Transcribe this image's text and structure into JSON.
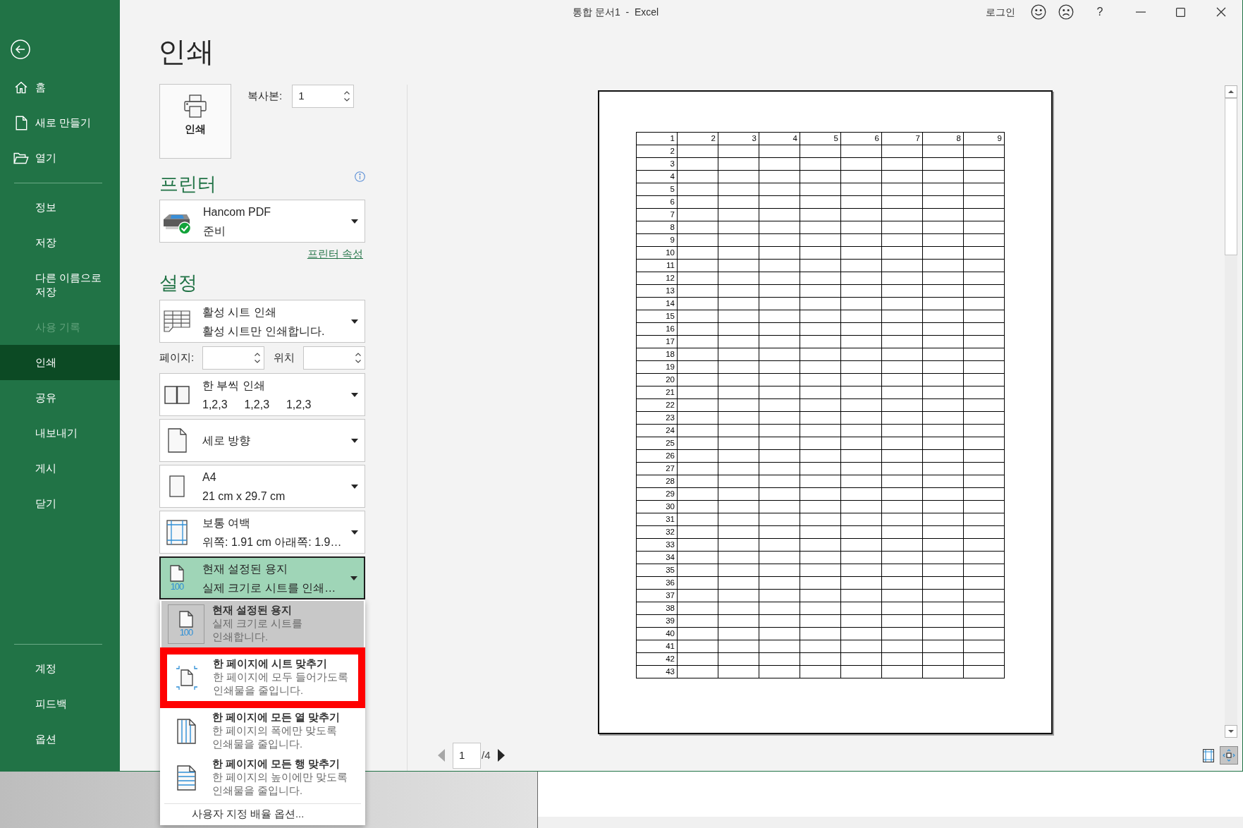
{
  "window": {
    "title": "통합 문서1  -  Excel",
    "sign_in": "로그인",
    "help": "?"
  },
  "nav": {
    "top": [
      {
        "label": "홈",
        "kind": "home",
        "selected": false
      },
      {
        "label": "새로 만들기",
        "kind": "new",
        "selected": false
      },
      {
        "label": "열기",
        "kind": "open",
        "selected": false
      }
    ],
    "main": [
      {
        "label": "정보",
        "selected": false,
        "disabled": false
      },
      {
        "label": "저장",
        "selected": false,
        "disabled": false
      },
      {
        "label": "다른 이름으로 저장",
        "selected": false,
        "disabled": false
      },
      {
        "label": "사용 기록",
        "selected": false,
        "disabled": true
      },
      {
        "label": "인쇄",
        "selected": true,
        "disabled": false
      },
      {
        "label": "공유",
        "selected": false,
        "disabled": false
      },
      {
        "label": "내보내기",
        "selected": false,
        "disabled": false
      },
      {
        "label": "게시",
        "selected": false,
        "disabled": false
      },
      {
        "label": "닫기",
        "selected": false,
        "disabled": false
      }
    ],
    "bottom": [
      {
        "label": "계정",
        "selected": false
      },
      {
        "label": "피드백",
        "selected": false
      },
      {
        "label": "옵션",
        "selected": false
      }
    ]
  },
  "print": {
    "heading": "인쇄",
    "button": "인쇄",
    "copies_label": "복사본:",
    "copies": "1"
  },
  "printer": {
    "heading": "프린터",
    "name": "Hancom PDF",
    "status": "준비",
    "properties_link": "프린터 속성"
  },
  "settings": {
    "heading": "설정",
    "items": [
      {
        "kind": "sheets",
        "title": "활성 시트 인쇄",
        "subtitle": "활성 시트만 인쇄합니다.",
        "expanded": false
      },
      {
        "kind": "pages",
        "from_label": "페이지:",
        "to_label": "위치"
      },
      {
        "kind": "collation",
        "title": "한 부씩 인쇄",
        "subtitle": [
          "1,2,3",
          "1,2,3",
          "1,2,3"
        ],
        "expanded": false
      },
      {
        "kind": "orientation",
        "title": "세로 방향",
        "expanded": false
      },
      {
        "kind": "paper",
        "title": "A4",
        "subtitle": "21 cm x 29.7 cm",
        "expanded": false
      },
      {
        "kind": "margins",
        "title": "보통 여백",
        "subtitle": "위쪽: 1.91 cm 아래쪽: 1.9…",
        "expanded": false
      },
      {
        "kind": "scaling",
        "title": "현재 설정된 용지",
        "subtitle": "실제 크기로 시트를 인쇄…",
        "icon_label": "100",
        "expanded": true
      }
    ]
  },
  "scaling_menu": {
    "items": [
      {
        "kind": "actual-size",
        "title": "현재 설정된 용지",
        "description": "실제 크기로 시트를 인쇄합니다.",
        "icon_label": "100",
        "selected": true,
        "highlighted": false
      },
      {
        "kind": "fit-sheet",
        "title": "한 페이지에 시트 맞추기",
        "description": "한 페이지에 모두 들어가도록 인쇄물을 줄입니다.",
        "selected": false,
        "highlighted": true
      },
      {
        "kind": "fit-columns",
        "title": "한 페이지에 모든 열 맞추기",
        "description": "한 페이지의 폭에만 맞도록 인쇄물을 줄입니다.",
        "selected": false,
        "highlighted": false
      },
      {
        "kind": "fit-rows",
        "title": "한 페이지에 모든 행 맞추기",
        "description": "한 페이지의 높이에만 맞도록 인쇄물을 줄입니다.",
        "selected": false,
        "highlighted": false
      }
    ],
    "custom_option": "사용자 지정 배율 옵션..."
  },
  "preview": {
    "first_row": [
      "1",
      "2",
      "3",
      "4",
      "5",
      "6",
      "7",
      "8",
      "9"
    ],
    "first_column": [
      "2",
      "3",
      "4",
      "5",
      "6",
      "7",
      "8",
      "9",
      "10",
      "11",
      "12",
      "13",
      "14",
      "15",
      "16",
      "17",
      "18",
      "19",
      "20",
      "21",
      "22",
      "23",
      "24",
      "25",
      "26",
      "27",
      "28",
      "29",
      "30",
      "31",
      "32",
      "33",
      "34",
      "35",
      "36",
      "37",
      "38",
      "39",
      "40",
      "41",
      "42",
      "43"
    ],
    "page_nav": {
      "current": "1",
      "total": "/4",
      "prev_disabled": true,
      "next_disabled": false
    },
    "view_toggles": [
      {
        "kind": "margins",
        "selected": false
      },
      {
        "kind": "zoom-page",
        "selected": true
      }
    ]
  }
}
